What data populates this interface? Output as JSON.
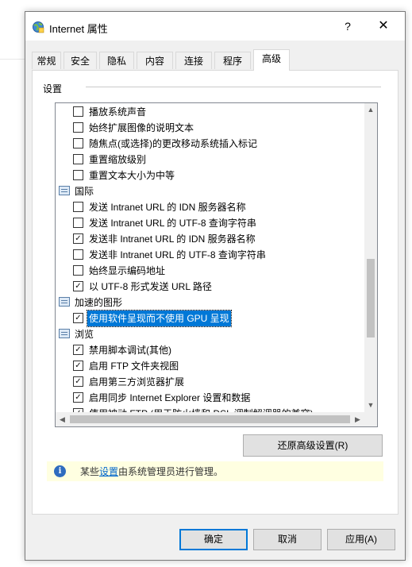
{
  "window": {
    "title": "Internet 属性",
    "help": "?",
    "close": "✕"
  },
  "tabs": [
    "常规",
    "安全",
    "隐私",
    "内容",
    "连接",
    "程序",
    "高级"
  ],
  "active_tab": "高级",
  "settings": {
    "group_label": "设置",
    "rows": [
      {
        "type": "option",
        "checked": false,
        "label": "播放系统声音"
      },
      {
        "type": "option",
        "checked": false,
        "label": "始终扩展图像的说明文本"
      },
      {
        "type": "option",
        "checked": false,
        "label": "随焦点(或选择)的更改移动系统插入标记"
      },
      {
        "type": "option",
        "checked": false,
        "label": "重置缩放级别"
      },
      {
        "type": "option",
        "checked": false,
        "label": "重置文本大小为中等"
      },
      {
        "type": "category",
        "label": "国际"
      },
      {
        "type": "option",
        "checked": false,
        "label": "发送 Intranet URL 的 IDN 服务器名称"
      },
      {
        "type": "option",
        "checked": false,
        "label": "发送 Intranet URL 的 UTF-8 查询字符串"
      },
      {
        "type": "option",
        "checked": true,
        "label": "发送非 Intranet URL 的 IDN 服务器名称"
      },
      {
        "type": "option",
        "checked": false,
        "label": "发送非 Intranet URL 的 UTF-8 查询字符串"
      },
      {
        "type": "option",
        "checked": false,
        "label": "始终显示编码地址"
      },
      {
        "type": "option",
        "checked": true,
        "label": "以 UTF-8 形式发送 URL 路径"
      },
      {
        "type": "category",
        "label": "加速的图形"
      },
      {
        "type": "option",
        "checked": true,
        "selected": true,
        "label": "使用软件呈现而不使用 GPU 呈现"
      },
      {
        "type": "category",
        "label": "浏览"
      },
      {
        "type": "option",
        "checked": true,
        "label": "禁用脚本调试(其他)"
      },
      {
        "type": "option",
        "checked": true,
        "label": "启用 FTP 文件夹视图"
      },
      {
        "type": "option",
        "checked": true,
        "label": "启用第三方浏览器扩展"
      },
      {
        "type": "option",
        "checked": true,
        "label": "启用同步 Internet Explorer 设置和数据"
      },
      {
        "type": "option",
        "checked": true,
        "label": "使用被动 FTP (用于防火墙和 DSL 调制解调器的兼容)"
      }
    ]
  },
  "restore_button": "还原高级设置(R)",
  "info": {
    "prefix": "某些",
    "link": "设置",
    "suffix": "由系统管理员进行管理。"
  },
  "buttons": {
    "ok": "确定",
    "cancel": "取消",
    "apply": "应用(A)"
  }
}
